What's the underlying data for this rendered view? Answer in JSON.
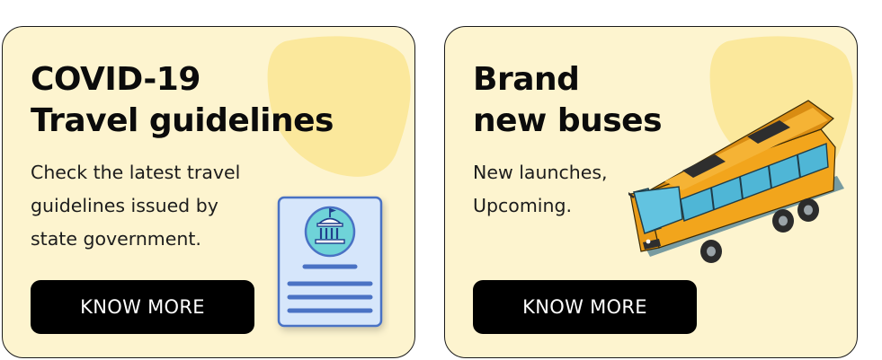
{
  "cards": [
    {
      "title_line1": "COVID-19",
      "title_line2": "Travel guidelines",
      "desc_line1": "Check the latest travel",
      "desc_line2": "guidelines issued by",
      "desc_line3": "state government.",
      "button_label": "KNOW MORE",
      "illustration_icon": "government-document-icon"
    },
    {
      "title_line1": "Brand",
      "title_line2": "new buses",
      "desc_line1": "New launches,",
      "desc_line2": "Upcoming.",
      "button_label": "KNOW MORE",
      "illustration_icon": "bus-icon"
    }
  ],
  "colors": {
    "card_background": "#fdf4cf",
    "blob": "#fbe89c",
    "button_background": "#000000",
    "button_text": "#ffffff",
    "document_fill": "#d6e6fb",
    "document_lines": "#4a72c4",
    "bus_body": "#f2a51c",
    "bus_windows": "#4fb6d6"
  }
}
